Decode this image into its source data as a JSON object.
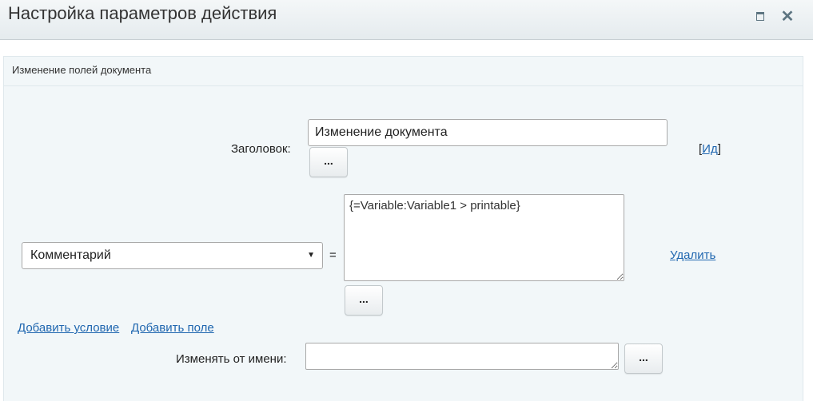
{
  "window": {
    "title": "Настройка параметров действия",
    "maximize_icon": "maximize-icon",
    "close_icon": "close-icon",
    "close_glyph": "✕"
  },
  "panel": {
    "title": "Изменение полей документа"
  },
  "form": {
    "title_label": "Заголовок:",
    "title_value": "Изменение документа",
    "title_dots": "...",
    "id_link_open": "[",
    "id_link": "Ид",
    "id_link_close": "]",
    "field_select_value": "Комментарий",
    "field_select_arrow": "▼",
    "equals": "=",
    "field_value": "{=Variable:Variable1 > printable}",
    "field_dots": "...",
    "delete_link": "Удалить",
    "add_condition_link": "Добавить условие",
    "add_field_link": "Добавить поле",
    "modify_by_label": "Изменять от имени:",
    "modify_by_value": "",
    "modify_by_dots": "..."
  },
  "colors": {
    "link": "#2067b0",
    "panel_background": "#f2f7f9",
    "titlebar_background": "#e5ebee"
  }
}
